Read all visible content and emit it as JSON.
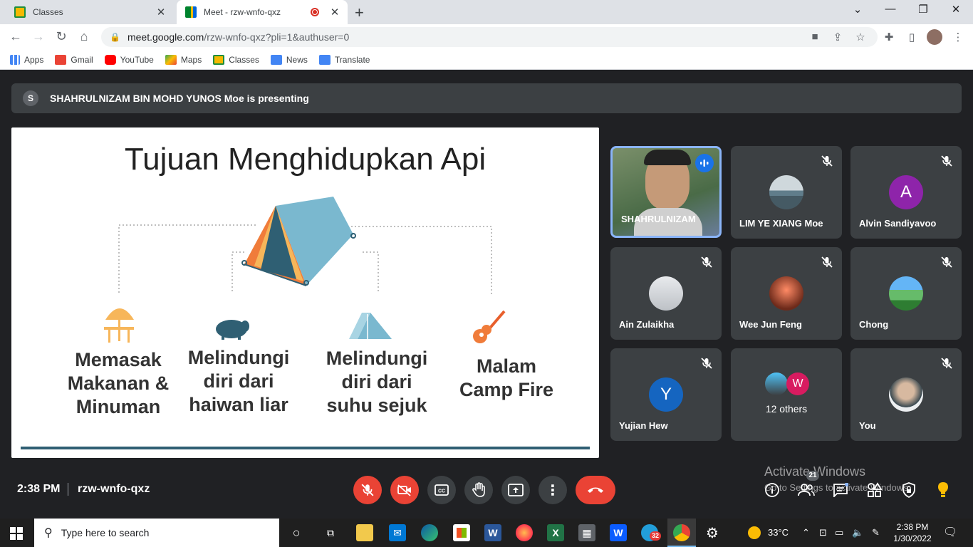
{
  "browser": {
    "tabs": [
      {
        "title": "Classes",
        "active": false
      },
      {
        "title": "Meet - rzw-wnfo-qxz",
        "active": true
      }
    ],
    "url_host": "meet.google.com",
    "url_path": "/rzw-wnfo-qxz?pli=1&authuser=0",
    "bookmarks": [
      "Apps",
      "Gmail",
      "YouTube",
      "Maps",
      "Classes",
      "News",
      "Translate"
    ]
  },
  "meet": {
    "presenter_initial": "S",
    "presenting_text": "SHAHRULNIZAM BIN MOHD YUNOS Moe is presenting",
    "slide": {
      "title": "Tujuan Menghidupkan Api",
      "items": [
        {
          "lines": [
            "Memasak",
            "Makanan &",
            "Minuman"
          ],
          "icon": "picnic-table-icon"
        },
        {
          "lines": [
            "Melindungi",
            "diri dari",
            "haiwan liar"
          ],
          "icon": "boar-icon"
        },
        {
          "lines": [
            "Melindungi",
            "diri dari",
            "suhu sejuk"
          ],
          "icon": "tent-icon"
        },
        {
          "lines": [
            "Malam",
            "Camp Fire"
          ],
          "icon": "guitar-icon"
        }
      ]
    },
    "participants": [
      {
        "name": "SHAHRULNIZAM",
        "speaking": true
      },
      {
        "name": "LIM YE XIANG Moe"
      },
      {
        "name": "Alvin Sandiyavoo",
        "initial": "A",
        "color": "#8e24aa"
      },
      {
        "name": "Ain Zulaikha"
      },
      {
        "name": "Wee Jun Feng"
      },
      {
        "name": "Chong"
      },
      {
        "name": "Yujian Hew",
        "initial": "Y",
        "color": "#1565c0"
      },
      {
        "name": "12 others",
        "initial": "W"
      },
      {
        "name": "You"
      }
    ],
    "time": "2:38 PM",
    "meeting_code": "rzw-wnfo-qxz",
    "people_count": "21",
    "watermark_line1": "Activate Windows",
    "watermark_line2": "Go to Settings to activate Windows."
  },
  "taskbar": {
    "search_placeholder": "Type here to search",
    "temperature": "33°C",
    "clock_time": "2:38 PM",
    "clock_date": "1/30/2022",
    "telegram_badge": "32"
  }
}
